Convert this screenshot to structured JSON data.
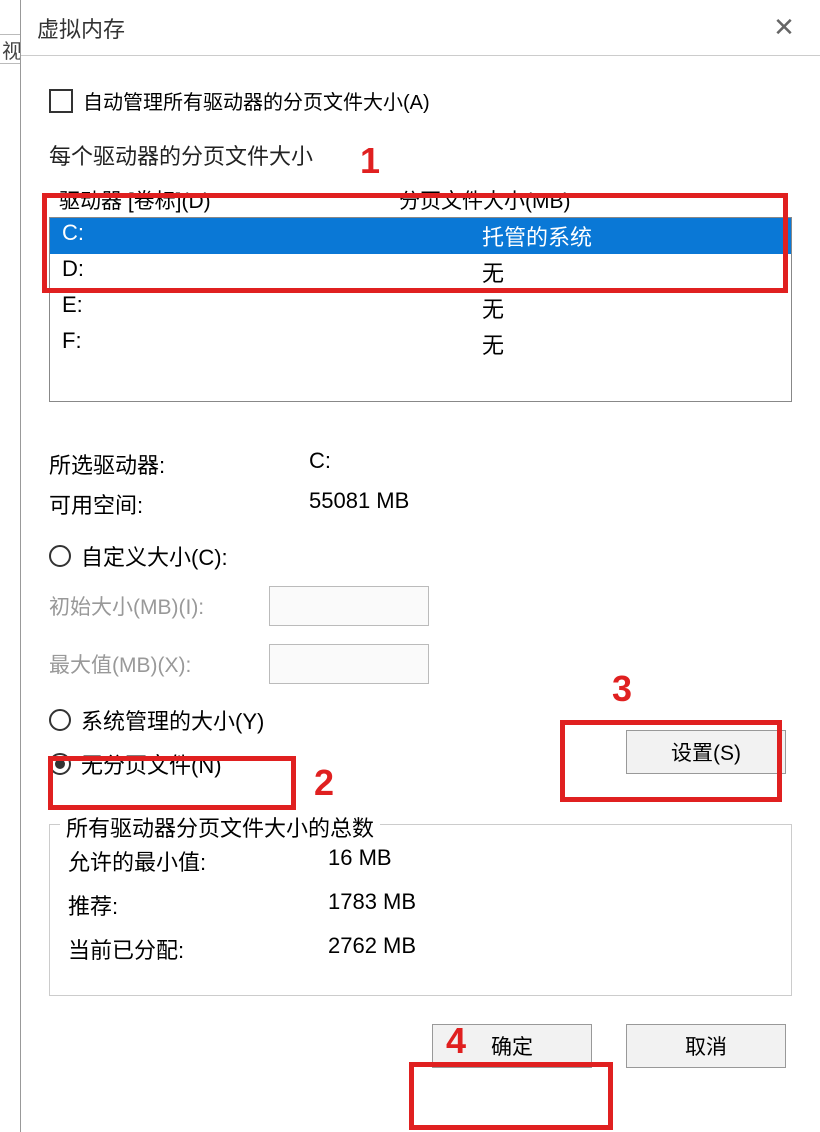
{
  "bg_edge_text": "视",
  "title": "虚拟内存",
  "checkbox_auto_label": "自动管理所有驱动器的分页文件大小(A)",
  "per_drive_label": "每个驱动器的分页文件大小",
  "headers": {
    "drive": "驱动器 [卷标](D)",
    "size": "分页文件大小(MB)"
  },
  "drives": [
    {
      "name": "C:",
      "size": "托管的系统",
      "selected": true
    },
    {
      "name": "D:",
      "size": "无",
      "selected": false
    },
    {
      "name": "E:",
      "size": "无",
      "selected": false
    },
    {
      "name": "F:",
      "size": "无",
      "selected": false
    }
  ],
  "selected_drive": {
    "label": "所选驱动器:",
    "value": "C:"
  },
  "available_space": {
    "label": "可用空间:",
    "value": "55081 MB"
  },
  "radio_custom": "自定义大小(C):",
  "initial_size_label": "初始大小(MB)(I):",
  "max_size_label": "最大值(MB)(X):",
  "radio_system": "系统管理的大小(Y)",
  "radio_none": "无分页文件(N)",
  "set_button": "设置(S)",
  "group_title": "所有驱动器分页文件大小的总数",
  "totals": {
    "min": {
      "label": "允许的最小值:",
      "value": "16 MB"
    },
    "recommended": {
      "label": "推荐:",
      "value": "1783 MB"
    },
    "allocated": {
      "label": "当前已分配:",
      "value": "2762 MB"
    }
  },
  "ok_button": "确定",
  "cancel_button": "取消",
  "annotations": {
    "n1": "1",
    "n2": "2",
    "n3": "3",
    "n4": "4"
  }
}
